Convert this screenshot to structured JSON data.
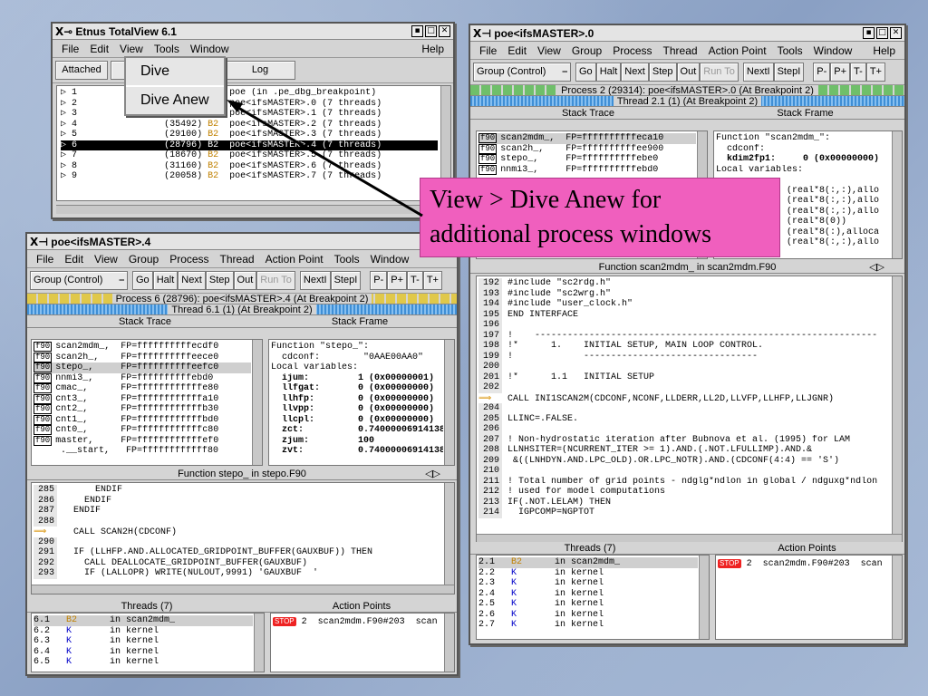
{
  "tv": {
    "title": "Etnus TotalView 6.1",
    "menus": [
      "File",
      "Edit",
      "View",
      "Tools",
      "Window"
    ],
    "help": "Help",
    "attached": "Attached",
    "log": "Log",
    "rows": [
      {
        "n": "1",
        "pid": "",
        "st": "",
        "name": "poe (in .pe_dbg_breakpoint)"
      },
      {
        "n": "2",
        "pid": "",
        "st": "",
        "name": "poe<ifsMASTER>.0 (7 threads)"
      },
      {
        "n": "3",
        "pid": "",
        "st": "",
        "name": "poe<ifsMASTER>.1 (7 threads)"
      },
      {
        "n": "4",
        "pid": "(35492)",
        "st": "B2",
        "name": "poe<ifsMASTER>.2 (7 threads)"
      },
      {
        "n": "5",
        "pid": "(29100)",
        "st": "B2",
        "name": "poe<ifsMASTER>.3 (7 threads)"
      },
      {
        "n": "6",
        "pid": "(28796)",
        "st": "B2",
        "name": "poe<ifsMASTER>.4 (7 threads)"
      },
      {
        "n": "7",
        "pid": "(18670)",
        "st": "B2",
        "name": "poe<ifsMASTER>.5 (7 threads)"
      },
      {
        "n": "8",
        "pid": "(31160)",
        "st": "B2",
        "name": "poe<ifsMASTER>.6 (7 threads)"
      },
      {
        "n": "9",
        "pid": "(20058)",
        "st": "B2",
        "name": "poe<ifsMASTER>.7 (7 threads)"
      }
    ],
    "ctx": {
      "dive": "Dive",
      "dive_anew": "Dive Anew"
    }
  },
  "toolbar": {
    "group": "Group (Control)",
    "go": "Go",
    "halt": "Halt",
    "next": "Next",
    "step": "Step",
    "out": "Out",
    "runto": "Run To",
    "nexti": "NextI",
    "stepi": "StepI",
    "pm": "P-",
    "pp": "P+",
    "tm": "T-",
    "tp": "T+"
  },
  "win_menus": [
    "File",
    "Edit",
    "View",
    "Group",
    "Process",
    "Thread",
    "Action Point",
    "Tools",
    "Window"
  ],
  "labels": {
    "stack_trace": "Stack Trace",
    "stack_frame": "Stack Frame",
    "threads": "Threads (7)",
    "action_points": "Action Points"
  },
  "w0": {
    "title": "poe<ifsMASTER>.0",
    "status1": "Process 2 (29314): poe<ifsMASTER>.0 (At Breakpoint 2)",
    "status2": "Thread 2.1 (1) (At Breakpoint 2)",
    "trace": [
      {
        "l": "f90",
        "f": "scan2mdm_,",
        "fp": "FP=ffffffffffeca10"
      },
      {
        "l": "f90",
        "f": "scan2h_,",
        "fp": "FP=ffffffffffee900"
      },
      {
        "l": "f90",
        "f": "stepo_,",
        "fp": "FP=ffffffffffebe0"
      },
      {
        "l": "f90",
        "f": "nnmi3_,",
        "fp": "FP=ffffffffffebd0"
      }
    ],
    "frame": [
      "Function \"scan2mdm_\":",
      "  cdconf:",
      "  kdim2fp1:     0 (0x00000000)",
      "Local variables:",
      "  ",
      "             (real*8(:,:),allo",
      "             (real*8(:,:),allo",
      "             (real*8(:,:),allo",
      "             (real*8(0))",
      "             (real*8(:),alloca",
      "             (real*8(:,:),allo"
    ],
    "func": "Function scan2mdm_ in scan2mdm.F90",
    "src": [
      {
        "n": "192",
        "t": "#include \"sc2rdg.h\""
      },
      {
        "n": "193",
        "t": "#include \"sc2wrg.h\""
      },
      {
        "n": "194",
        "t": "#include \"user_clock.h\""
      },
      {
        "n": "195",
        "t": "END INTERFACE"
      },
      {
        "n": "196",
        "t": ""
      },
      {
        "n": "197",
        "t": "!    ---------------------------------------------------------------"
      },
      {
        "n": "198",
        "t": "!*      1.    INITIAL SETUP, MAIN LOOP CONTROL."
      },
      {
        "n": "199",
        "t": "!             --------------------------------"
      },
      {
        "n": "200",
        "t": ""
      },
      {
        "n": "201",
        "t": "!*      1.1   INITIAL SETUP"
      },
      {
        "n": "202",
        "t": ""
      },
      {
        "n": "",
        "t": "CALL INI1SCAN2M(CDCONF,NCONF,LLDERR,LL2D,LLVFP,LLHFP,LLJGNR)",
        "arrow": true
      },
      {
        "n": "204",
        "t": ""
      },
      {
        "n": "205",
        "t": "LLINC=.FALSE."
      },
      {
        "n": "206",
        "t": ""
      },
      {
        "n": "207",
        "t": "! Non-hydrostatic iteration after Bubnova et al. (1995) for LAM"
      },
      {
        "n": "208",
        "t": "LLNHSITER=(NCURRENT_ITER >= 1).AND.(.NOT.LFULLIMP).AND.&"
      },
      {
        "n": "209",
        "t": " &((LNHDYN.AND.LPC_OLD).OR.LPC_NOTR).AND.(CDCONF(4:4) == 'S')"
      },
      {
        "n": "210",
        "t": ""
      },
      {
        "n": "211",
        "t": "! Total number of grid points - ndglg*ndlon in global / ndguxg*ndlon"
      },
      {
        "n": "212",
        "t": "! used for model computations"
      },
      {
        "n": "213",
        "t": "IF(.NOT.LELAM) THEN"
      },
      {
        "n": "214",
        "t": "  IGPCOMP=NGPTOT"
      }
    ],
    "threads": [
      {
        "id": "2.1",
        "s": "B2",
        "w": "in scan2mdm_"
      },
      {
        "id": "2.2",
        "s": "K",
        "w": "in kernel"
      },
      {
        "id": "2.3",
        "s": "K",
        "w": "in kernel"
      },
      {
        "id": "2.4",
        "s": "K",
        "w": "in kernel"
      },
      {
        "id": "2.5",
        "s": "K",
        "w": "in kernel"
      },
      {
        "id": "2.6",
        "s": "K",
        "w": "in kernel"
      },
      {
        "id": "2.7",
        "s": "K",
        "w": "in kernel"
      }
    ],
    "ap": {
      "stop": "STOP",
      "n": "2",
      "loc": "scan2mdm.F90#203  scan"
    }
  },
  "w4": {
    "title": "poe<ifsMASTER>.4",
    "status1": "Process 6 (28796): poe<ifsMASTER>.4 (At Breakpoint 2)",
    "status2": "Thread 6.1 (1) (At Breakpoint 2)",
    "trace": [
      {
        "l": "f90",
        "f": "scan2mdm_,",
        "fp": "FP=ffffffffffecdf0"
      },
      {
        "l": "f90",
        "f": "scan2h_,",
        "fp": "FP=ffffffffffeece0"
      },
      {
        "l": "f90",
        "f": "stepo_,",
        "fp": "FP=ffffffffffeefc0"
      },
      {
        "l": "f90",
        "f": "nnmi3_,",
        "fp": "FP=ffffffffffebd0"
      },
      {
        "l": "f90",
        "f": "cmac_,",
        "fp": "FP=ffffffffffffe80"
      },
      {
        "l": "f90",
        "f": "cnt3_,",
        "fp": "FP=ffffffffffffa10"
      },
      {
        "l": "f90",
        "f": "cnt2_,",
        "fp": "FP=ffffffffffffb30"
      },
      {
        "l": "f90",
        "f": "cnt1_,",
        "fp": "FP=ffffffffffffbd0"
      },
      {
        "l": "f90",
        "f": "cnt0_,",
        "fp": "FP=ffffffffffffc80"
      },
      {
        "l": "f90",
        "f": "master,",
        "fp": "FP=ffffffffffffef0"
      },
      {
        "l": "",
        "f": ".__start,",
        "fp": "FP=ffffffffffff80"
      }
    ],
    "frame": [
      "Function \"stepo_\":",
      "  cdconf:        \"0AAE00AA0\"",
      "Local variables:",
      "  ijum:         1 (0x00000001)",
      "  llfgat:       0 (0x00000000)",
      "  llhfp:        0 (0x00000000)",
      "  llvpp:        0 (0x00000000)",
      "  llcpl:        0 (0x00000000)",
      "  zct:          0.740000069141388",
      "  zjum:         100",
      "  zvt:          0.740000069141388"
    ],
    "func": "Function stepo_ in stepo.F90",
    "src": [
      {
        "n": "285",
        "t": "      ENDIF"
      },
      {
        "n": "286",
        "t": "    ENDIF"
      },
      {
        "n": "287",
        "t": "  ENDIF"
      },
      {
        "n": "288",
        "t": ""
      },
      {
        "n": "",
        "t": "  CALL SCAN2H(CDCONF)",
        "arrow": true
      },
      {
        "n": "290",
        "t": ""
      },
      {
        "n": "291",
        "t": "  IF (LLHFP.AND.ALLOCATED_GRIDPOINT_BUFFER(GAUXBUF)) THEN"
      },
      {
        "n": "292",
        "t": "    CALL DEALLOCATE_GRIDPOINT_BUFFER(GAUXBUF)"
      },
      {
        "n": "293",
        "t": "    IF (LALLOPR) WRITE(NULOUT,9991) 'GAUXBUF  '"
      }
    ],
    "threads": [
      {
        "id": "6.1",
        "s": "B2",
        "w": "in scan2mdm_"
      },
      {
        "id": "6.2",
        "s": "K",
        "w": "in kernel"
      },
      {
        "id": "6.3",
        "s": "K",
        "w": "in kernel"
      },
      {
        "id": "6.4",
        "s": "K",
        "w": "in kernel"
      },
      {
        "id": "6.5",
        "s": "K",
        "w": "in kernel"
      }
    ],
    "ap": {
      "stop": "STOP",
      "n": "2",
      "loc": "scan2mdm.F90#203  scan"
    }
  },
  "callout": {
    "line1": "View >  Dive Anew for",
    "line2": "additional process windows"
  }
}
